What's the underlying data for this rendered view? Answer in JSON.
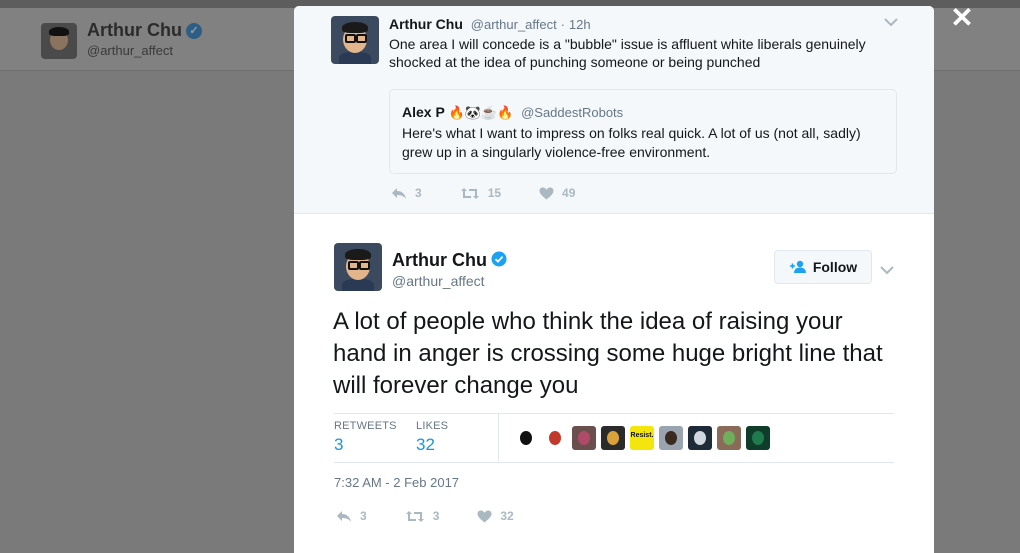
{
  "background": {
    "name": "Arthur Chu",
    "handle": "@arthur_affect"
  },
  "close_label": "✕",
  "ancestor": {
    "name": "Arthur Chu",
    "handle": "@arthur_affect",
    "separator": "·",
    "time": "12h",
    "text": "One area I will concede is a \"bubble\" issue is affluent white liberals genuinely shocked at the idea of punching someone or being punched",
    "quote": {
      "name": "Alex P",
      "emoji": "🔥🐼☕🔥",
      "handle": "@SaddestRobots",
      "text": "Here's what I want to impress on folks real quick. A lot of us (not all, sadly) grew up in a singularly violence-free environment."
    },
    "actions": {
      "replies": "3",
      "retweets": "15",
      "likes": "49"
    }
  },
  "tweet": {
    "name": "Arthur Chu",
    "handle": "@arthur_affect",
    "follow_label": "Follow",
    "text": "A lot of people who think the idea of raising your hand in anger is crossing some huge bright line that will forever change you",
    "retweets_label": "RETWEETS",
    "retweets": "3",
    "likes_label": "LIKES",
    "likes": "32",
    "likers": [
      {
        "name": "diamond-avatar",
        "color": "#ffffff",
        "accent": "#111111"
      },
      {
        "name": "rabbit-avatar",
        "color": "#ffffff",
        "accent": "#c0392b"
      },
      {
        "name": "flowers-avatar",
        "color": "#6b4e4e",
        "accent": "#b04a6a"
      },
      {
        "name": "food-avatar",
        "color": "#2b2b2b",
        "accent": "#d9a23a"
      },
      {
        "name": "resist-avatar",
        "color": "#f4e60c",
        "accent": "#111111",
        "label": "Resist."
      },
      {
        "name": "portrait-avatar",
        "color": "#9aa4b0",
        "accent": "#3a2a20"
      },
      {
        "name": "dark-avatar",
        "color": "#1e2a38",
        "accent": "#d0d7de"
      },
      {
        "name": "plant-avatar",
        "color": "#8a6b5a",
        "accent": "#6fae5a"
      },
      {
        "name": "green-avatar",
        "color": "#0f3d2a",
        "accent": "#1f7a4e"
      }
    ],
    "date": "7:32 AM - 2 Feb 2017",
    "actions": {
      "replies": "3",
      "retweets": "3",
      "likes": "32"
    }
  }
}
